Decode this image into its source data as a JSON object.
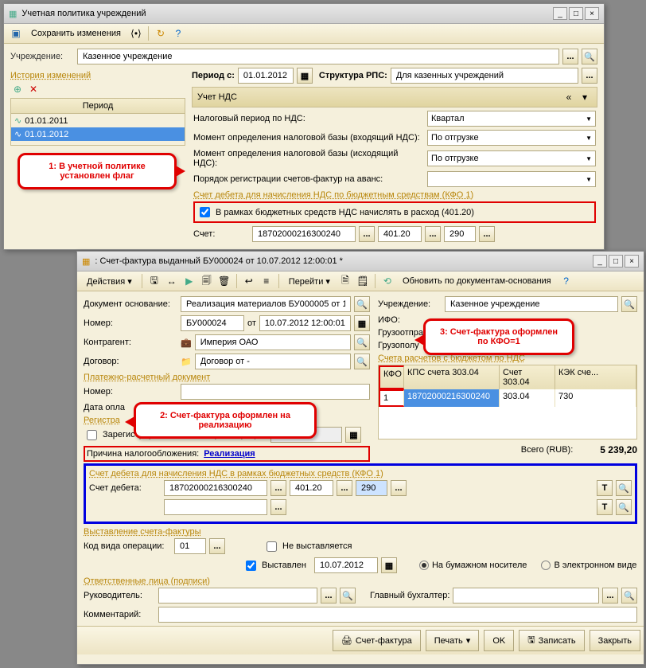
{
  "win1": {
    "title": "Учетная политика учреждений",
    "toolbar": {
      "save": "Сохранить изменения"
    },
    "inst_label": "Учреждение:",
    "inst_value": "Казенное учреждение",
    "history": {
      "header": "История изменений",
      "col": "Период",
      "rows": [
        "01.01.2011",
        "01.01.2012"
      ]
    },
    "period_label": "Период с:",
    "period_value": "01.01.2012",
    "rps_label": "Структура РПС:",
    "rps_value": "Для казенных учреждений",
    "vat_group": "Учет НДС",
    "vat": {
      "period_label": "Налоговый период по НДС:",
      "period_value": "Квартал",
      "in_label": "Момент определения налоговой базы (входящий НДС):",
      "in_value": "По отгрузке",
      "out_label": "Момент определения налоговой базы (исходящий НДС):",
      "out_value": "По отгрузке",
      "advance_label": "Порядок регистрации счетов-фактур на аванс:",
      "advance_value": "",
      "debit_header": "Счет дебета для начисления НДС по бюджетным средствам (КФО 1)",
      "chk_label": "В рамках бюджетных средств НДС начислять в расход (401.20)",
      "acc_label": "Счет:",
      "acc1": "18702000216300240",
      "acc2": "401.20",
      "acc3": "290"
    }
  },
  "win2": {
    "title": ": Счет-фактура выданный БУ000024 от 10.07.2012 12:00:01 *",
    "toolbar": {
      "actions": "Действия",
      "go": "Перейти",
      "refresh": "Обновить по документам-основания"
    },
    "left": {
      "doc_basis_label": "Документ основание:",
      "doc_basis_value": "Реализация материалов БУ000005 от 1",
      "num_label": "Номер:",
      "num_value": "БУ000024",
      "from": "от",
      "date_value": "10.07.2012 12:00:01",
      "counter_label": "Контрагент:",
      "counter_value": "Империя ОАО",
      "contract_label": "Договор:",
      "contract_value": "Договор от -",
      "pay_header": "Платежно-расчетный документ",
      "pay_num_label": "Номер:",
      "pay_date_label": "Дата опла",
      "reg_header": "Регистра",
      "reg_chk": "Зарегистрировать",
      "reg_date_label": "та регистрации:",
      "reason_label": "Причина налогообложения:",
      "reason_value": "Реализация"
    },
    "right": {
      "inst_label": "Учреждение:",
      "inst_value": "Казенное учреждение",
      "ifo_label": "ИФО:",
      "consignor_label": "Грузоотпра",
      "consignee_label": "Грузополу",
      "table_header": "Счета расчетов с бюджетом по НДС",
      "cols": {
        "kfo": "КФО",
        "kps": "КПС счета 303.04",
        "acc": "Счет 303.04",
        "kek": "КЭК сче..."
      },
      "row": {
        "kfo": "1",
        "kps": "18702000216300240",
        "acc": "303.04",
        "kek": "730"
      },
      "total_label": "Всего (RUB):",
      "total_value": "5 239,20"
    },
    "debit": {
      "header": "Счет дебета для начисления НДС в рамках бюджетных средств (КФО 1)",
      "label": "Счет дебета:",
      "v1": "18702000216300240",
      "v2": "401.20",
      "v3": "290"
    },
    "issue": {
      "header": "Выставление счета-фактуры",
      "op_label": "Код вида операции:",
      "op_value": "01",
      "not_issued": "Не выставляется",
      "issued": "Выставлен",
      "issue_date": "10.07.2012",
      "paper": "На бумажном носителе",
      "electronic": "В электронном виде"
    },
    "sign": {
      "header": "Ответственные лица (подписи)",
      "mgr": "Руководитель:",
      "acc": "Главный бухгалтер:",
      "comment": "Комментарий:"
    },
    "buttons": {
      "sf": "Счет-фактура",
      "print": "Печать",
      "ok": "OK",
      "save": "Записать",
      "close": "Закрыть"
    }
  },
  "callouts": {
    "c1": "1: В учетной политике установлен флаг",
    "c2": "2: Счет-фактура оформлен на реализацию",
    "c3": "3: Счет-фактура оформлен по КФО=1"
  }
}
